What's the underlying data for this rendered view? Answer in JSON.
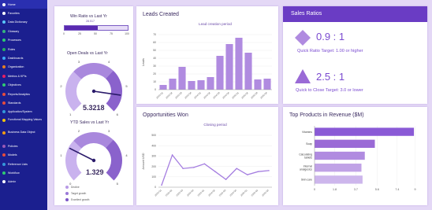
{
  "sidebar": {
    "items": [
      {
        "label": "Home",
        "color": "#ffffff"
      },
      {
        "label": "Favorites",
        "color": "#ffffff"
      },
      {
        "label": "Data Dictionary",
        "color": "#5ac8fa"
      },
      {
        "label": "Glossary",
        "color": "#36b37e"
      },
      {
        "label": "Processes",
        "color": "#2ecc71"
      },
      {
        "label": "Roles",
        "color": "#27ae60"
      },
      {
        "label": "Dashboards",
        "color": "#3fa9f5"
      },
      {
        "label": "Organization",
        "color": "#e67e22"
      },
      {
        "label": "Metrics & KPIs",
        "color": "#e91e63"
      },
      {
        "label": "Objectives",
        "color": "#2ecc71"
      },
      {
        "label": "Reports/Analytics",
        "color": "#e74c3c"
      },
      {
        "label": "Standards",
        "color": "#e74c3c"
      },
      {
        "label": "Application/System",
        "color": "#3498db"
      },
      {
        "label": "Functional Mapping Values",
        "color": "#f1c40f"
      },
      {
        "label": "Business Data Object",
        "color": "#f39c12"
      },
      {
        "label": "Policies",
        "color": "#9b59b6"
      },
      {
        "label": "Models",
        "color": "#e74c3c"
      },
      {
        "label": "Reference Lists",
        "color": "#3498db"
      },
      {
        "label": "Workflow",
        "color": "#2ecc71"
      },
      {
        "label": "Admin",
        "color": "#ffffff"
      }
    ]
  },
  "panel_gauges": {
    "win_ratio": {
      "title": "Win Ratio vs Last Yr",
      "value_text": "28.517",
      "ticks": [
        "0",
        "25",
        "50",
        "75",
        "100"
      ],
      "progress": 0.52
    },
    "open_deals": {
      "title": "Open Deals vs Last Yr",
      "value": "5.3218",
      "ticks": [
        "1",
        "2",
        "3",
        "4",
        "5",
        "6"
      ],
      "min": 1,
      "max": 6,
      "reading": 5.3218
    },
    "ytd_sales": {
      "title": "YTD Sales vs Last Yr",
      "value": "1.329",
      "ticks": [
        "0",
        "1",
        "2",
        "3",
        "4",
        "5"
      ],
      "min": 0,
      "max": 5,
      "reading": 1.329
    },
    "legend": [
      "Decline",
      "Target growth",
      "Excellent growth"
    ]
  },
  "panel_leads": {
    "title": "Leads Created",
    "chart_data": {
      "type": "bar",
      "title": "Lead creation period",
      "ylabel": "Leads",
      "ylim": [
        0,
        70
      ],
      "yticks": [
        "0",
        "10",
        "20",
        "30",
        "40",
        "50",
        "60",
        "70"
      ],
      "categories": [
        "2023-Q1",
        "2023-Q2",
        "2023-Q3",
        "2023-Q4",
        "2024-Q1",
        "2024-Q2",
        "2024-Q3",
        "2024-Q4",
        "2025-Q1",
        "2025-Q2",
        "2025-Q3",
        "2025-Q4"
      ],
      "values": [
        6,
        14,
        29,
        11,
        12,
        16,
        43,
        58,
        66,
        47,
        13,
        14
      ]
    }
  },
  "panel_sales": {
    "title": "Sales Ratios",
    "quick": {
      "value": "0.9 : 1",
      "label": "Quick Ratio Target: 1.00 or higher"
    },
    "close": {
      "value": "2.5 : 1",
      "label": "Quick to Close Target: 3.0 or lower"
    }
  },
  "panel_opps": {
    "title": "Opportunities Won",
    "chart_data": {
      "type": "line",
      "title": "Closing period",
      "ylabel": "Amount USD",
      "ylim": [
        0,
        500
      ],
      "yticks": [
        "0",
        "100",
        "200",
        "300",
        "400",
        "500"
      ],
      "categories": [
        "2023-Q1",
        "2023-Q2",
        "2023-Q3",
        "2023-Q4",
        "2024-Q1",
        "2024-Q2",
        "2024-Q3",
        "2024-Q4",
        "2025-Q1",
        "2025-Q2",
        "2025-Q3"
      ],
      "values": [
        20,
        310,
        180,
        190,
        225,
        150,
        75,
        180,
        120,
        150,
        160
      ]
    }
  },
  "panel_products": {
    "title": "Top Products in Revenue ($M)",
    "chart_data": {
      "type": "bar",
      "orientation": "horizontal",
      "categories": [
        "Vitamins",
        "Soap",
        "Calculating tablets",
        "Internal analgesics",
        "Skin care"
      ],
      "values": [
        8.9,
        5.4,
        4.5,
        4.2,
        4.3
      ],
      "xticks": [
        "0",
        "1.8",
        "3.7",
        "5.6",
        "7.4",
        "9"
      ],
      "xlim": [
        0,
        9.6
      ]
    }
  }
}
